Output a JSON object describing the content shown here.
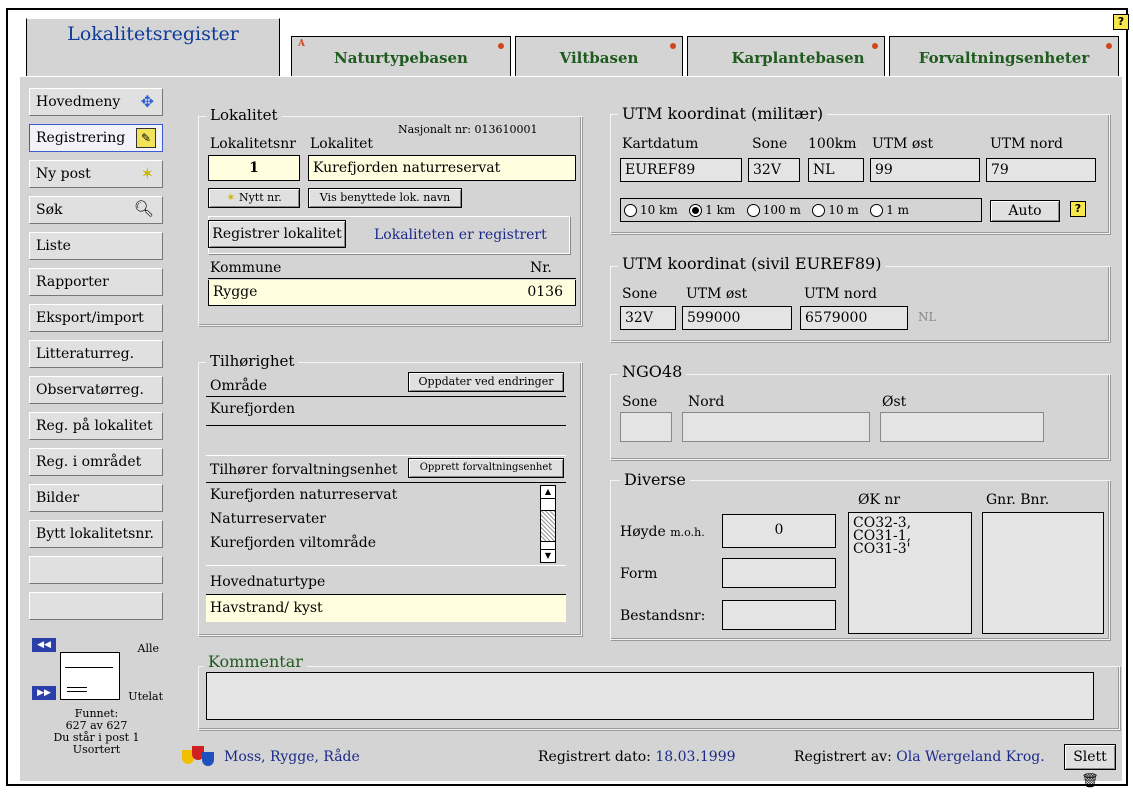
{
  "tabs": [
    {
      "label": "Lokalitetsregister"
    },
    {
      "label": "Naturtypebasen",
      "mark": "A"
    },
    {
      "label": "Viltbasen"
    },
    {
      "label": "Karplantebasen"
    },
    {
      "label": "Forvaltningsenheter"
    }
  ],
  "help_glyph": "?",
  "nav": [
    {
      "label": "Hovedmeny",
      "icon": "arrows-icon"
    },
    {
      "label": "Registrering",
      "icon": "edit-icon"
    },
    {
      "label": "Ny post",
      "icon": "new-icon"
    },
    {
      "label": "Søk",
      "icon": "search-icon"
    },
    {
      "label": "Liste"
    },
    {
      "label": "Rapporter"
    },
    {
      "label": "Eksport/import"
    },
    {
      "label": "Litteraturreg."
    },
    {
      "label": "Observatørreg."
    },
    {
      "label": "Reg. på lokalitet"
    },
    {
      "label": "Reg. i området"
    },
    {
      "label": "Bilder"
    },
    {
      "label": "Bytt lokalitetsnr."
    },
    {
      "label": ""
    },
    {
      "label": ""
    }
  ],
  "browser": {
    "all": "Alle",
    "exclude": "Utelat",
    "found_label": "Funnet:",
    "found": "627 av 627",
    "post": "Du står i post 1",
    "sort": "Usortert"
  },
  "lokalitet": {
    "title": "Lokalitet",
    "nasjonalt": "Nasjonalt nr: 013610001",
    "nr_label": "Lokalitetsnr",
    "name_label": "Lokalitet",
    "nr": "1",
    "name": "Kurefjorden naturreservat",
    "nytt_btn": "Nytt nr.",
    "vis_btn": "Vis benyttede lok. navn",
    "registrer_btn": "Registrer lokalitet",
    "status": "Lokaliteten er registrert",
    "kommune_label": "Kommune",
    "knr_label": "Nr.",
    "kommune": "Rygge",
    "knr": "0136"
  },
  "tilhorighet": {
    "title": "Tilhørighet",
    "omrade_label": "Område",
    "oppdater_btn": "Oppdater ved endringer",
    "omrade": "Kurefjorden",
    "forv_label": "Tilhører forvaltningsenhet",
    "opprett_btn": "Opprett forvaltningsenhet",
    "forv_items": [
      "Kurefjorden naturreservat",
      "Naturreservater",
      "Kurefjorden viltområde"
    ],
    "hoved_label": "Hovednaturtype",
    "hoved": "Havstrand/ kyst"
  },
  "utm_mil": {
    "title": "UTM koordinat (militær)",
    "headers": [
      "Kartdatum",
      "Sone",
      "100km",
      "UTM øst",
      "UTM nord"
    ],
    "values": [
      "EUREF89",
      "32V",
      "NL",
      "99",
      "79"
    ],
    "options": [
      "10 km",
      "1 km",
      "100 m",
      "10 m",
      "1 m"
    ],
    "selected": 1,
    "auto_btn": "Auto"
  },
  "utm_civ": {
    "title": "UTM koordinat (sivil EUREF89)",
    "headers": [
      "Sone",
      "UTM øst",
      "UTM nord"
    ],
    "values": [
      "32V",
      "599000",
      "6579000"
    ],
    "suffix": "NL"
  },
  "ngo": {
    "title": "NGO48",
    "headers": [
      "Sone",
      "Nord",
      "Øst"
    ]
  },
  "diverse": {
    "title": "Diverse",
    "hoyde_label": "Høyde",
    "moh": "m.o.h.",
    "hoyde": "0",
    "form_label": "Form",
    "bestand_label": "Bestandsnr:",
    "ok_label": "ØK nr",
    "ok": [
      "CO32-3,",
      "CO31-1,",
      "CO31-3'"
    ],
    "gnr_label": "Gnr. Bnr."
  },
  "kommentar": {
    "title": "Kommentar"
  },
  "footer": {
    "region": "Moss, Rygge, Råde",
    "reg_dato_label": "Registrert dato:",
    "reg_dato": "18.03.1999",
    "reg_av_label": "Registrert av:",
    "reg_av": "Ola Wergeland Krog.",
    "slett": "Slett"
  }
}
